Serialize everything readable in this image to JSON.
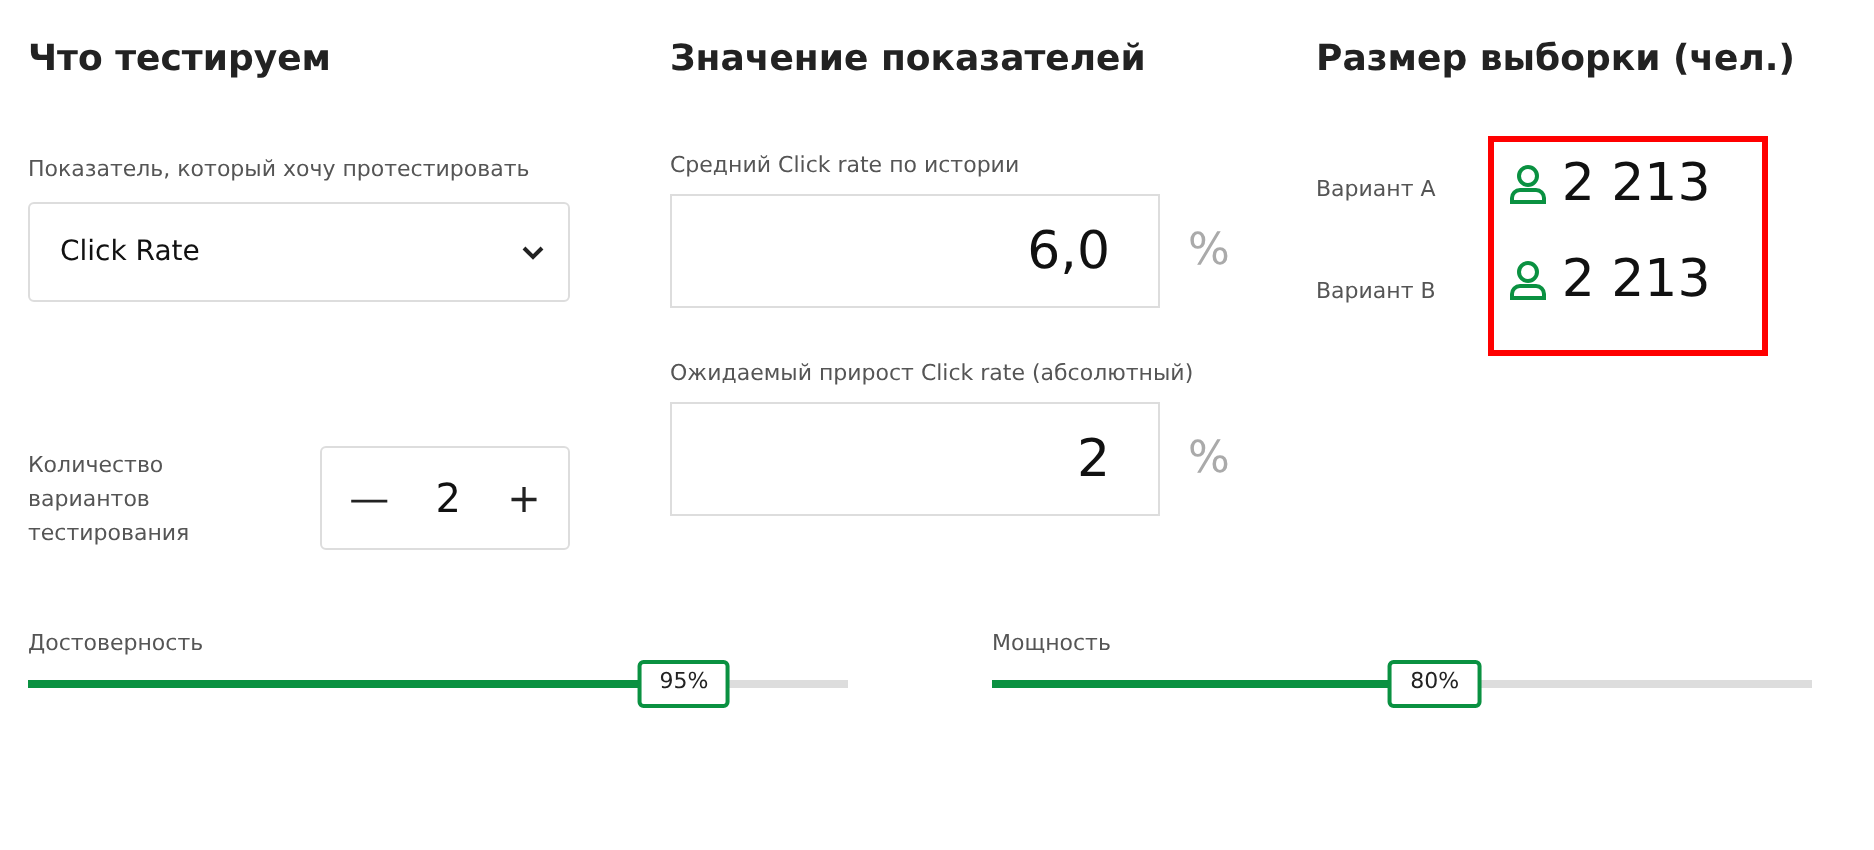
{
  "sections": [
    {
      "title": "Что тестируем"
    },
    {
      "title": "Значение показателей"
    },
    {
      "title": "Размер выборки (чел.)"
    }
  ],
  "metric": {
    "label": "Показатель, который хочу протестировать",
    "value": "Click Rate"
  },
  "variants_count": {
    "label": "Количество вариантов тестирования",
    "minus": "—",
    "value": "2",
    "plus": "+"
  },
  "inputs": [
    {
      "label": "Средний Click rate по истории",
      "value": "6,0",
      "unit": "%"
    },
    {
      "label": "Ожидаемый прирост Click rate (абсолютный)",
      "value": "2",
      "unit": "%"
    }
  ],
  "results": {
    "highlighted": true,
    "items": [
      {
        "label": "Вариант A",
        "count": "2 213"
      },
      {
        "label": "Вариант B",
        "count": "2 213"
      }
    ]
  },
  "sliders": [
    {
      "label": "Достоверность",
      "level": 0.8,
      "reading": "95%"
    },
    {
      "label": "Мощность",
      "level": 0.54,
      "reading": "80%"
    }
  ]
}
